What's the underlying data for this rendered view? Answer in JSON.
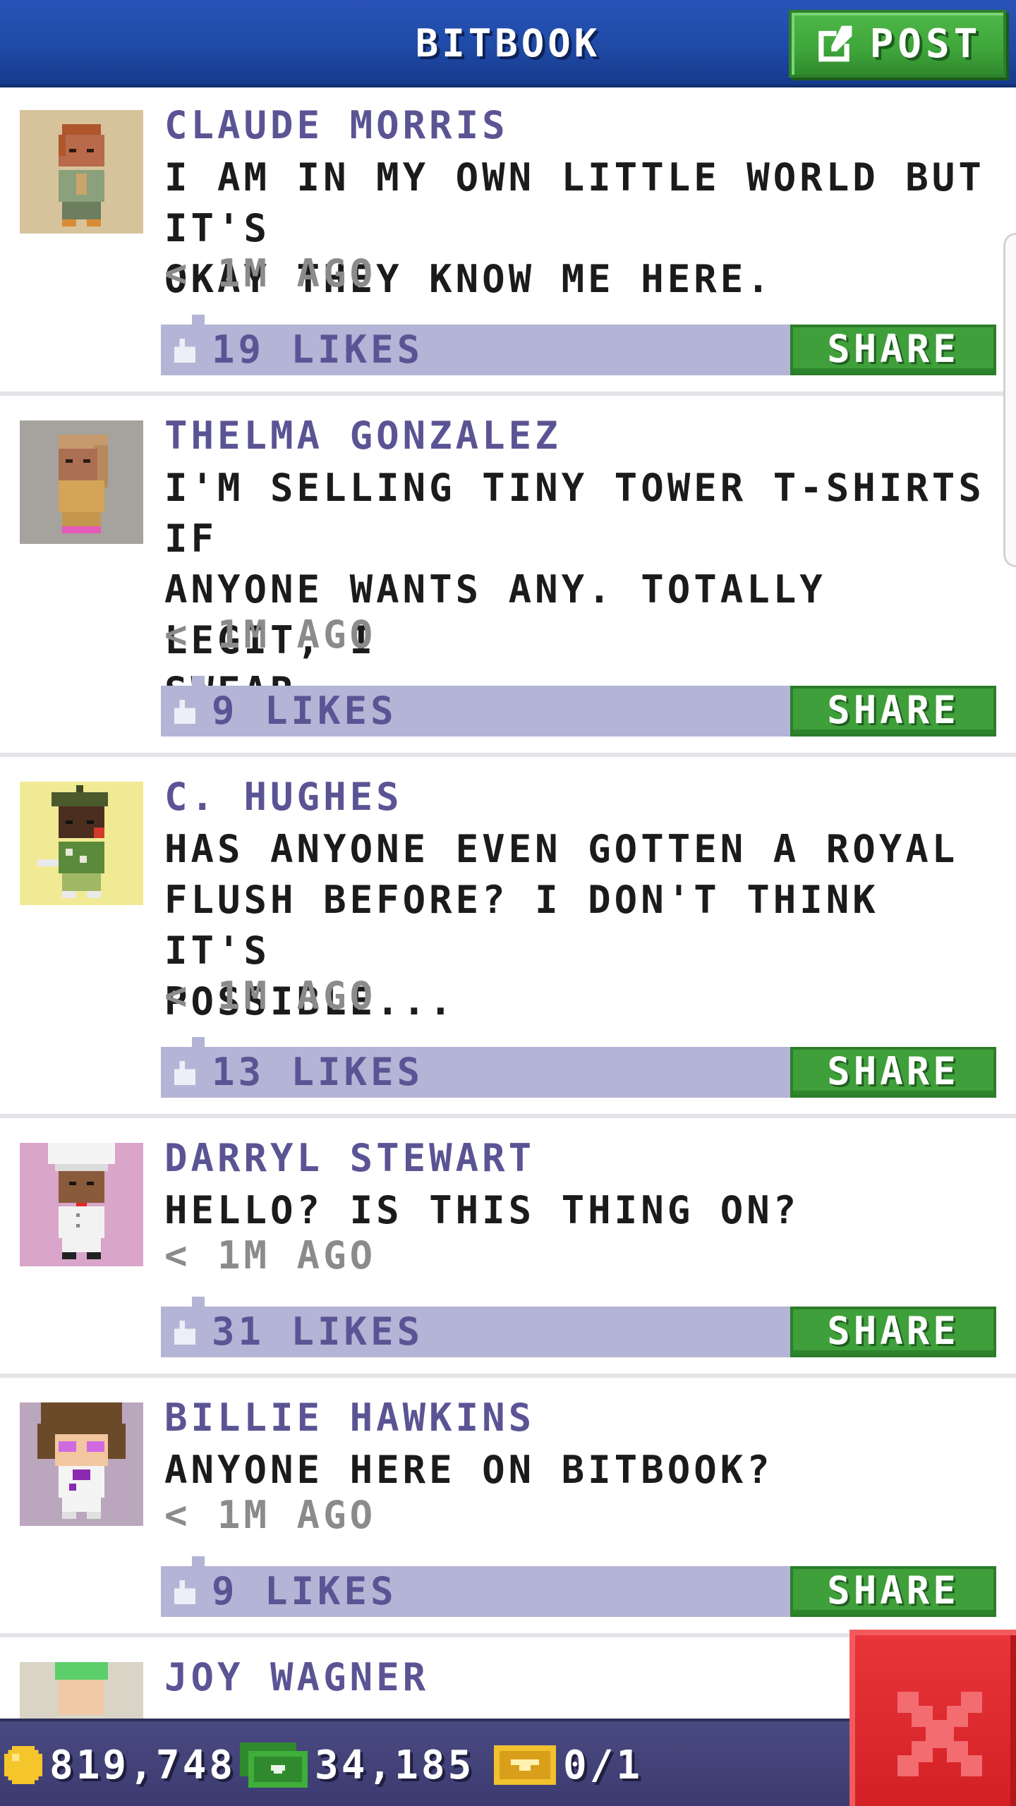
{
  "header": {
    "title": "BITBOOK",
    "post_label": "POST"
  },
  "posts": [
    {
      "name": "CLAUDE MORRIS",
      "message": "I AM IN MY OWN LITTLE WORLD BUT IT'S\nOKAY THEY KNOW ME HERE.",
      "time": "< 1M AGO",
      "likes": "19 LIKES",
      "share": "SHARE",
      "avatar_bg": "#d6c39b"
    },
    {
      "name": "THELMA GONZALEZ",
      "message": "I'M SELLING TINY TOWER T-SHIRTS IF\nANYONE WANTS ANY. TOTALLY LEGIT, I\nSWEAR.",
      "time": "< 1M AGO",
      "likes": "9 LIKES",
      "share": "SHARE",
      "avatar_bg": "#a6a29d"
    },
    {
      "name": "C. HUGHES",
      "message": "HAS ANYONE EVEN GOTTEN A ROYAL\nFLUSH BEFORE? I DON'T THINK IT'S\nPOSSIBLE...",
      "time": "< 1M AGO",
      "likes": "13 LIKES",
      "share": "SHARE",
      "avatar_bg": "#f1ea94"
    },
    {
      "name": "DARRYL STEWART",
      "message": "HELLO? IS THIS THING ON?",
      "time": "< 1M AGO",
      "likes": "31 LIKES",
      "share": "SHARE",
      "avatar_bg": "#d9a5c8"
    },
    {
      "name": "BILLIE HAWKINS",
      "message": "ANYONE HERE ON BITBOOK?",
      "time": "< 1M AGO",
      "likes": "9 LIKES",
      "share": "SHARE",
      "avatar_bg": "#bba7bd"
    },
    {
      "name": "JOY WAGNER",
      "message": "",
      "time": "",
      "likes": "",
      "share": "",
      "avatar_bg": "#d9d4c6"
    }
  ],
  "bottom_bar": {
    "coins": "819,748",
    "bux": "34,185",
    "tickets": "0/1"
  },
  "colors": {
    "header_blue": "#1f4aa6",
    "accent_green": "#3f9f3a",
    "likes_bar": "#b4b4d6",
    "name_purple": "#5b5494",
    "close_red": "#d22025"
  }
}
